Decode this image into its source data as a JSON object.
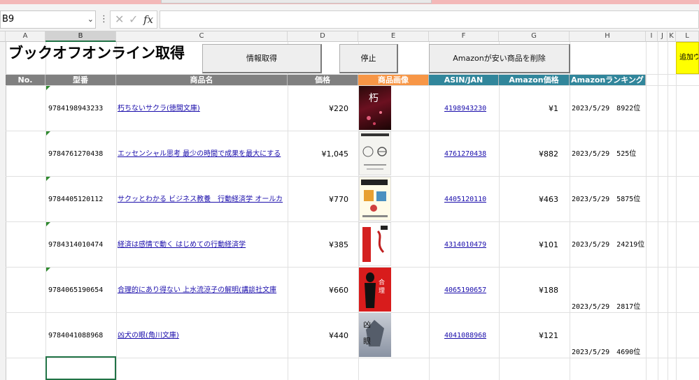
{
  "namebox": {
    "value": "B9"
  },
  "formula_bar": {
    "fx_label": "fx",
    "value": ""
  },
  "columns": [
    "A",
    "B",
    "C",
    "D",
    "E",
    "F",
    "G",
    "H",
    "I",
    "J",
    "K",
    "L"
  ],
  "sheet": {
    "title": "ブックオフオンライン取得",
    "buttons": {
      "fetch": "情報取得",
      "stop": "停止",
      "delete": "Amazonが安い商品を削除"
    },
    "extra_button": "追加ウ",
    "headers": [
      "No.",
      "型番",
      "商品名",
      "価格",
      "商品画像",
      "ASIN/JAN",
      "Amazon価格",
      "Amazonランキング"
    ],
    "rows": [
      {
        "code": "9784198943233",
        "name": "朽ちないサクラ(徳間文庫)",
        "price": "¥220",
        "asin": "4198943230",
        "amazon_price": "¥1",
        "ranking": "2023/5/29　8922位"
      },
      {
        "code": "9784761270438",
        "name": "エッセンシャル思考 最少の時間で成果を最大にする",
        "price": "¥1,045",
        "asin": "4761270438",
        "amazon_price": "¥882",
        "ranking": "2023/5/29　525位"
      },
      {
        "code": "9784405120112",
        "name": "サクッとわかる ビジネス教養　行動経済学 オールカ",
        "price": "¥770",
        "asin": "4405120110",
        "amazon_price": "¥463",
        "ranking": "2023/5/29　5875位"
      },
      {
        "code": "9784314010474",
        "name": "経済は感情で動く はじめての行動経済学",
        "price": "¥385",
        "asin": "4314010479",
        "amazon_price": "¥101",
        "ranking": "2023/5/29　24219位"
      },
      {
        "code": "9784065190654",
        "name": "合理的にあり得ない 上水流涼子の解明(講談社文庫",
        "price": "¥660",
        "asin": "4065190657",
        "amazon_price": "¥188",
        "ranking": "2023/5/29　2817位"
      },
      {
        "code": "9784041088968",
        "name": "凶犬の眼(角川文庫)",
        "price": "¥440",
        "asin": "4041088968",
        "amazon_price": "¥121",
        "ranking": "2023/5/29　4690位"
      }
    ]
  },
  "colors": {
    "header_gray": "#808080",
    "header_orange": "#f79646",
    "header_teal": "#31869b",
    "accent": "#217346",
    "link": "#1a0dab"
  }
}
